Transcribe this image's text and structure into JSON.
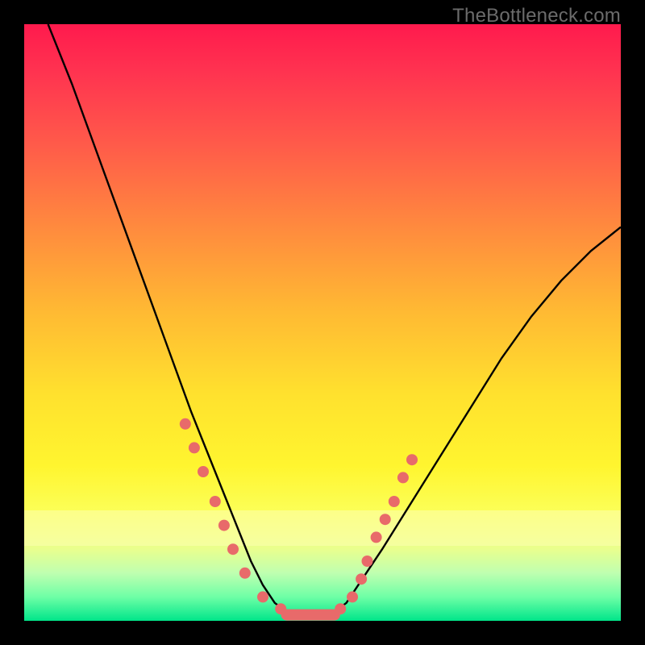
{
  "watermark": "TheBottleneck.com",
  "chart_data": {
    "type": "line",
    "title": "",
    "xlabel": "",
    "ylabel": "",
    "xlim": [
      0,
      100
    ],
    "ylim": [
      0,
      100
    ],
    "series": [
      {
        "name": "bottleneck-curve",
        "x": [
          4,
          8,
          12,
          16,
          20,
          24,
          28,
          30,
          32,
          34,
          36,
          38,
          40,
          42,
          44,
          46,
          48,
          50,
          52,
          54,
          56,
          60,
          65,
          70,
          75,
          80,
          85,
          90,
          95,
          100
        ],
        "y": [
          100,
          90,
          79,
          68,
          57,
          46,
          35,
          30,
          25,
          20,
          15,
          10,
          6,
          3,
          1.5,
          1,
          1,
          1,
          1.5,
          3,
          6,
          12,
          20,
          28,
          36,
          44,
          51,
          57,
          62,
          66
        ]
      }
    ],
    "markers": {
      "left": [
        {
          "x": 27,
          "y": 33
        },
        {
          "x": 28.5,
          "y": 29
        },
        {
          "x": 30,
          "y": 25
        },
        {
          "x": 32,
          "y": 20
        },
        {
          "x": 33.5,
          "y": 16
        },
        {
          "x": 35,
          "y": 12
        },
        {
          "x": 37,
          "y": 8
        },
        {
          "x": 40,
          "y": 4
        },
        {
          "x": 43,
          "y": 2
        }
      ],
      "right": [
        {
          "x": 53,
          "y": 2
        },
        {
          "x": 55,
          "y": 4
        },
        {
          "x": 56.5,
          "y": 7
        },
        {
          "x": 57.5,
          "y": 10
        },
        {
          "x": 59,
          "y": 14
        },
        {
          "x": 60.5,
          "y": 17
        },
        {
          "x": 62,
          "y": 20
        },
        {
          "x": 63.5,
          "y": 24
        },
        {
          "x": 65,
          "y": 27
        }
      ],
      "flat": [
        {
          "x": 44,
          "y": 1
        },
        {
          "x": 46,
          "y": 1
        },
        {
          "x": 48,
          "y": 1
        },
        {
          "x": 50,
          "y": 1
        },
        {
          "x": 52,
          "y": 1
        }
      ]
    },
    "colors": {
      "curve": "#000000",
      "marker": "#e86a6a",
      "top": "#ff1a4d",
      "bottom": "#00e58a"
    }
  }
}
